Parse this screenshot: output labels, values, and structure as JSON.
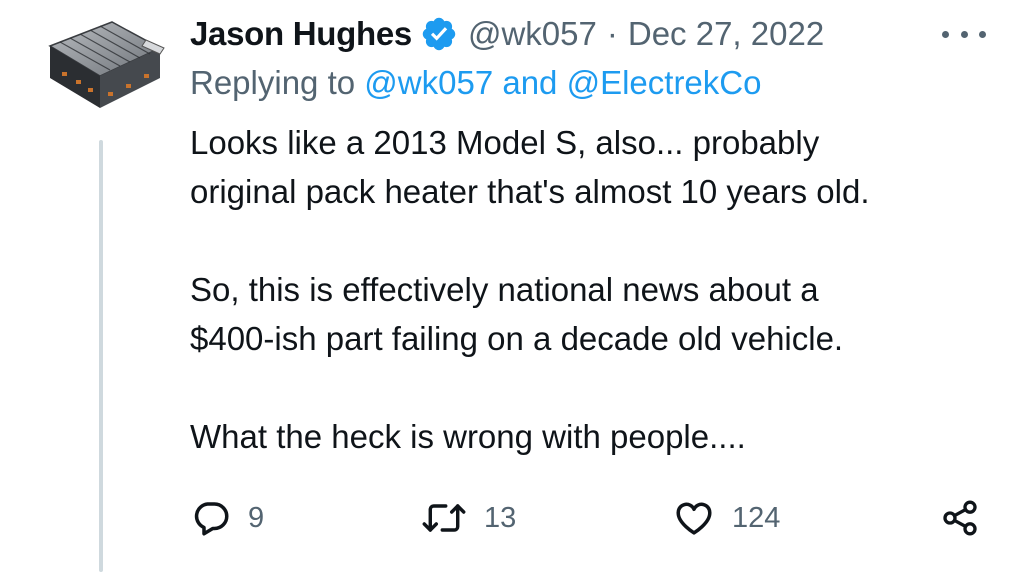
{
  "tweet": {
    "display_name": "Jason Hughes",
    "handle": "@wk057",
    "separator": "·",
    "date": "Dec 27, 2022",
    "reply_prefix": "Replying to",
    "reply_mention_1": "@wk057",
    "reply_and": "and",
    "reply_mention_2": "@ElectrekCo",
    "body": [
      "Looks like a 2013 Model S, also... probably",
      "original pack heater that's almost 10 years old.",
      "So, this is effectively national news about a",
      "$400-ish part failing on a decade old vehicle.",
      "What the heck is wrong with people...."
    ],
    "stats": {
      "replies": "9",
      "retweets": "13",
      "likes": "124"
    }
  },
  "icons": {
    "verified": "verified-badge-icon",
    "more": "more-dots-icon",
    "reply": "reply-bubble-icon",
    "retweet": "retweet-icon",
    "like": "heart-icon",
    "share": "share-icon"
  },
  "colors": {
    "accent": "#1d9bf0",
    "secondary_text": "#536471",
    "primary_text": "#0f1419"
  }
}
